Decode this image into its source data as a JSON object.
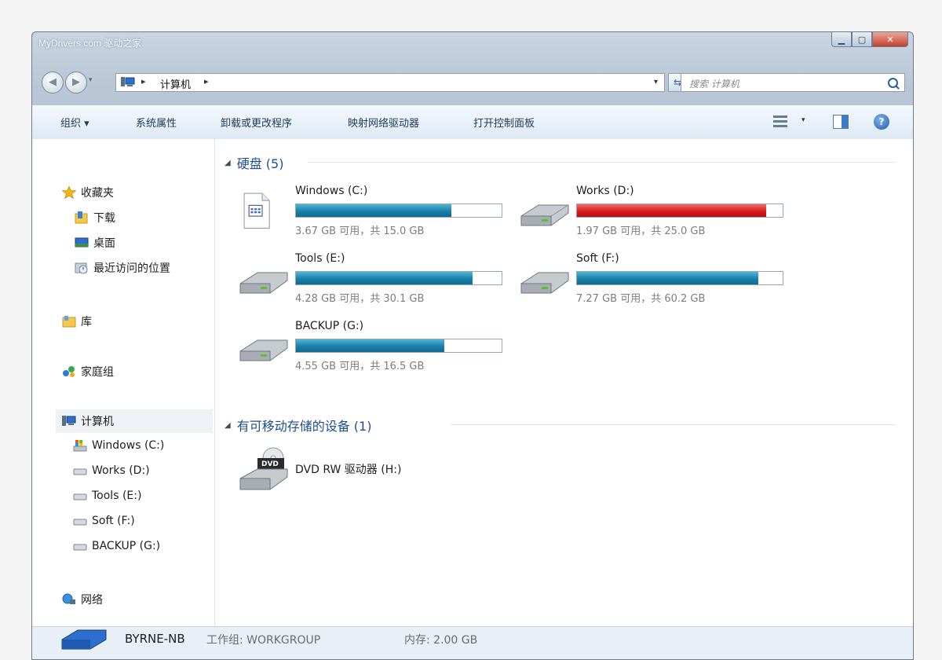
{
  "window": {
    "title": "MyDrivers.com 驱动之家"
  },
  "address": {
    "separator1": "▸",
    "path": "计算机",
    "separator2": "▸"
  },
  "search": {
    "placeholder": "搜索 计算机"
  },
  "toolbar": {
    "organize": "组织 ▾",
    "system_properties": "系统属性",
    "uninstall": "卸载或更改程序",
    "map_drive": "映射网络驱动器",
    "control_panel": "打开控制面板"
  },
  "sidebar": {
    "favorites": "收藏夹",
    "downloads": "下载",
    "desktop": "桌面",
    "recent": "最近访问的位置",
    "libraries": "库",
    "homegroup": "家庭组",
    "computer": "计算机",
    "drives": [
      {
        "label": "Windows (C:)"
      },
      {
        "label": "Works (D:)"
      },
      {
        "label": "Tools (E:)"
      },
      {
        "label": "Soft (F:)"
      },
      {
        "label": "BACKUP (G:)"
      }
    ],
    "network": "网络"
  },
  "content": {
    "hard_disks_header": "硬盘 (5)",
    "removable_header": "有可移动存储的设备 (1)",
    "drives": [
      {
        "name": "Windows (C:)",
        "info": "3.67 GB 可用，共 15.0 GB",
        "used_fraction": 0.755,
        "bar_color": "#1b7fa8"
      },
      {
        "name": "Works (D:)",
        "info": "1.97 GB 可用，共 25.0 GB",
        "used_fraction": 0.92,
        "bar_color": "#d81e1e"
      },
      {
        "name": "Tools (E:)",
        "info": "4.28 GB 可用，共 30.1 GB",
        "used_fraction": 0.86,
        "bar_color": "#1b7fa8"
      },
      {
        "name": "Soft (F:)",
        "info": "7.27 GB 可用，共 60.2 GB",
        "used_fraction": 0.88,
        "bar_color": "#1b7fa8"
      },
      {
        "name": "BACKUP (G:)",
        "info": "4.55 GB 可用，共 16.5 GB",
        "used_fraction": 0.72,
        "bar_color": "#1b7fa8"
      }
    ],
    "dvd": {
      "name": "DVD RW 驱动器 (H:)",
      "badge": "DVD"
    }
  },
  "status": {
    "computer_name": "BYRNE-NB",
    "workgroup": "工作组: WORKGROUP",
    "memory": "内存: 2.00 GB"
  }
}
